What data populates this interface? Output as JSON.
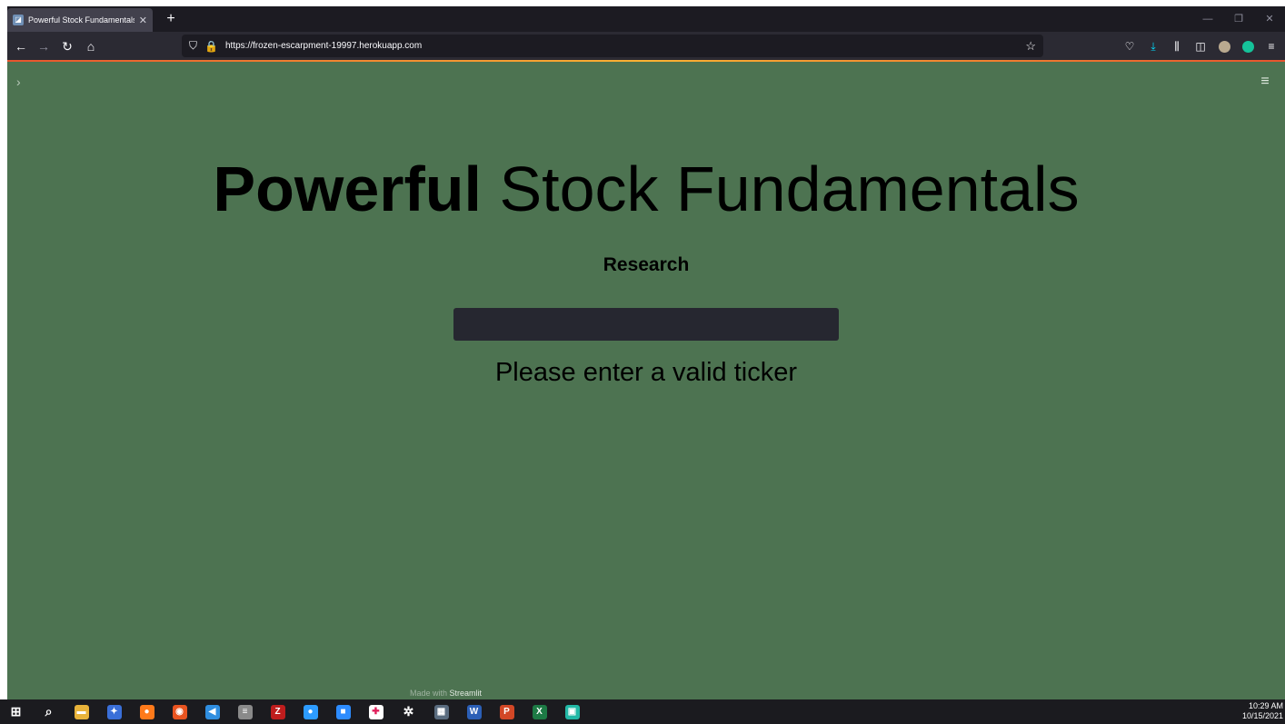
{
  "browser": {
    "tab": {
      "title": "Powerful Stock Fundamentals",
      "close_glyph": "✕",
      "favicon": "streamlit-favicon"
    },
    "new_tab_glyph": "+",
    "window_controls": {
      "minimize": "—",
      "restore": "❐",
      "close": "✕"
    },
    "nav": {
      "back": "←",
      "forward": "→",
      "reload": "↻",
      "home": "⌂"
    },
    "url": "https://frozen-escarpment-19997.herokuapp.com",
    "url_icons": {
      "shield": "⛉",
      "lock": "🔒",
      "star": "☆"
    },
    "toolbar": {
      "pocket": "♡",
      "downloads": "⤓",
      "library": "⫼",
      "sidebar": "◫",
      "menu": "≡"
    }
  },
  "page": {
    "title_bold": "Powerful",
    "title_rest": " Stock Fundamentals",
    "subheading": "Research",
    "input_value": "",
    "message": "Please enter a valid ticker",
    "sidebar_toggle": "›",
    "main_menu": "≡",
    "footer_prefix": "Made with ",
    "footer_brand": "Streamlit"
  },
  "taskbar": {
    "apps": [
      {
        "name": "start-icon",
        "glyph": "⊞",
        "color": "transparent"
      },
      {
        "name": "search-icon",
        "glyph": "⌕",
        "color": "transparent"
      },
      {
        "name": "file-explorer-icon",
        "glyph": "▬",
        "color": "#e8b33a"
      },
      {
        "name": "app-icon-1",
        "glyph": "✦",
        "color": "#3a6fd8"
      },
      {
        "name": "firefox-icon",
        "glyph": "●",
        "color": "#ff7a1a"
      },
      {
        "name": "ubuntu-icon",
        "glyph": "◉",
        "color": "#e95420"
      },
      {
        "name": "vscode-icon",
        "glyph": "◀",
        "color": "#2f8ee0"
      },
      {
        "name": "database-icon",
        "glyph": "≡",
        "color": "#8a8a8a"
      },
      {
        "name": "filezilla-icon",
        "glyph": "Z",
        "color": "#bf1d1d"
      },
      {
        "name": "app-icon-2",
        "glyph": "●",
        "color": "#2d9cff"
      },
      {
        "name": "zoom-icon",
        "glyph": "■",
        "color": "#2d8cff"
      },
      {
        "name": "slack-icon",
        "glyph": "✚",
        "color": "#ffffff"
      },
      {
        "name": "settings-icon",
        "glyph": "✲",
        "color": "transparent"
      },
      {
        "name": "calculator-icon",
        "glyph": "▦",
        "color": "#5a6c7f"
      },
      {
        "name": "word-icon",
        "glyph": "W",
        "color": "#2b5fb6"
      },
      {
        "name": "powerpoint-icon",
        "glyph": "P",
        "color": "#d24726"
      },
      {
        "name": "excel-icon",
        "glyph": "X",
        "color": "#1d7a45"
      },
      {
        "name": "app-icon-3",
        "glyph": "▣",
        "color": "#22b8a6"
      }
    ],
    "time": "10:29 AM",
    "date": "10/15/2021"
  }
}
